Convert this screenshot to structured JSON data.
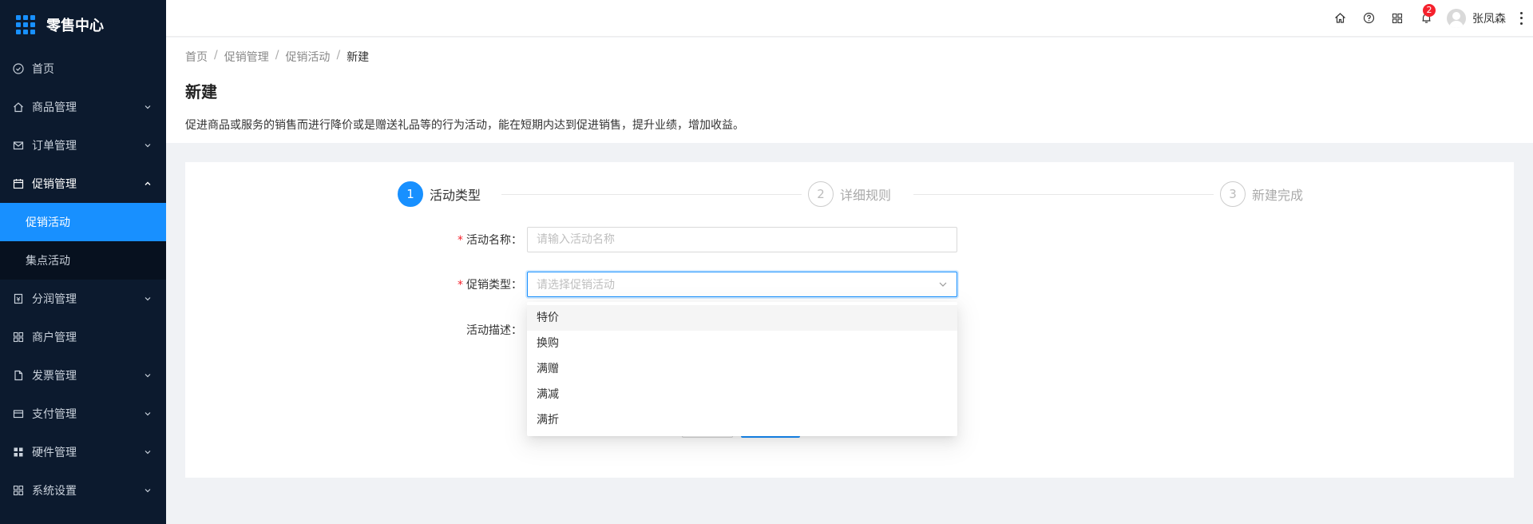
{
  "app": {
    "title": "零售中心"
  },
  "sidebar": {
    "items": [
      {
        "label": "首页",
        "icon": "home-circle-icon"
      },
      {
        "label": "商品管理",
        "icon": "house-icon"
      },
      {
        "label": "订单管理",
        "icon": "mail-icon"
      },
      {
        "label": "促销管理",
        "icon": "calendar-icon"
      },
      {
        "label": "分润管理",
        "icon": "receipt-icon"
      },
      {
        "label": "商户管理",
        "icon": "grid-icon"
      },
      {
        "label": "发票管理",
        "icon": "file-icon"
      },
      {
        "label": "支付管理",
        "icon": "card-icon"
      },
      {
        "label": "硬件管理",
        "icon": "apps-icon"
      },
      {
        "label": "系统设置",
        "icon": "grid-icon"
      }
    ],
    "sub_items": [
      {
        "label": "促销活动",
        "active": true
      },
      {
        "label": "集点活动",
        "active": false
      }
    ]
  },
  "header": {
    "notification_count": "2",
    "user_name": "张凤森"
  },
  "breadcrumb": [
    "首页",
    "促销管理",
    "促销活动",
    "新建"
  ],
  "page": {
    "title": "新建",
    "description": "促进商品或服务的销售而进行降价或是赠送礼品等的行为活动，能在短期内达到促进销售，提升业绩，增加收益。"
  },
  "steps": [
    {
      "number": "1",
      "label": "活动类型",
      "active": true
    },
    {
      "number": "2",
      "label": "详细规则",
      "active": false
    },
    {
      "number": "3",
      "label": "新建完成",
      "active": false
    }
  ],
  "form": {
    "name_label": "活动名称：",
    "name_placeholder": "请输入活动名称",
    "type_label": "促销类型：",
    "type_placeholder": "请选择促销活动",
    "desc_label": "活动描述："
  },
  "dropdown": {
    "options": [
      "特价",
      "换购",
      "满赠",
      "满减",
      "满折"
    ]
  },
  "colors": {
    "primary": "#1890ff",
    "sidebar_bg": "#0c1a2e",
    "required": "#f5222d"
  }
}
